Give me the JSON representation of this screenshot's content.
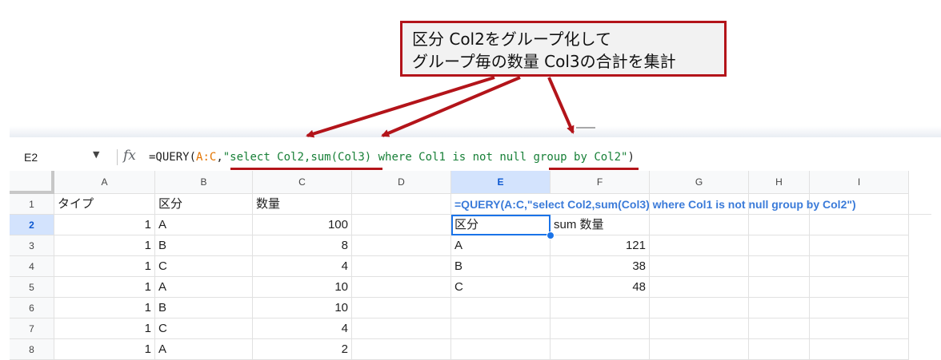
{
  "callout": {
    "line1": "区分 Col2をグループ化して",
    "line2": "グループ毎の数量 Col3の合計を集計"
  },
  "formula_bar": {
    "name_box": "E2",
    "fx_label": "fx",
    "formula_prefix": "=QUERY(",
    "formula_range": "A:C",
    "formula_comma": ",",
    "formula_string": "\"select Col2,sum(Col3) where Col1 is not null group by Col2\"",
    "formula_suffix": ")"
  },
  "sheet": {
    "columns": [
      "A",
      "B",
      "C",
      "D",
      "E",
      "F",
      "G",
      "H",
      "I"
    ],
    "rows": [
      "1",
      "2",
      "3",
      "4",
      "5",
      "6",
      "7",
      "8"
    ],
    "header_row": {
      "A": "タイプ",
      "B": "区分",
      "C": "数量"
    },
    "data": [
      {
        "A": "1",
        "B": "A",
        "C": "100"
      },
      {
        "A": "1",
        "B": "B",
        "C": "8"
      },
      {
        "A": "1",
        "B": "C",
        "C": "4"
      },
      {
        "A": "1",
        "B": "A",
        "C": "10"
      },
      {
        "A": "1",
        "B": "B",
        "C": "10"
      },
      {
        "A": "1",
        "B": "C",
        "C": "4"
      },
      {
        "A": "1",
        "B": "A",
        "C": "2"
      }
    ],
    "e1_formula_display": "=QUERY(A:C,\"select Col2,sum(Col3) where Col1 is not null group by Col2\")",
    "result": {
      "headers": [
        "区分",
        "sum 数量"
      ],
      "rows": [
        {
          "key": "A",
          "sum": "121"
        },
        {
          "key": "B",
          "sum": "38"
        },
        {
          "key": "C",
          "sum": "48"
        }
      ]
    },
    "selected_cell": "E2"
  },
  "colors": {
    "annotation_red": "#b3141a",
    "formula_blue": "#3b7bd9",
    "range_orange": "#e37400",
    "string_green": "#188038",
    "selection_blue": "#1a73e8"
  }
}
